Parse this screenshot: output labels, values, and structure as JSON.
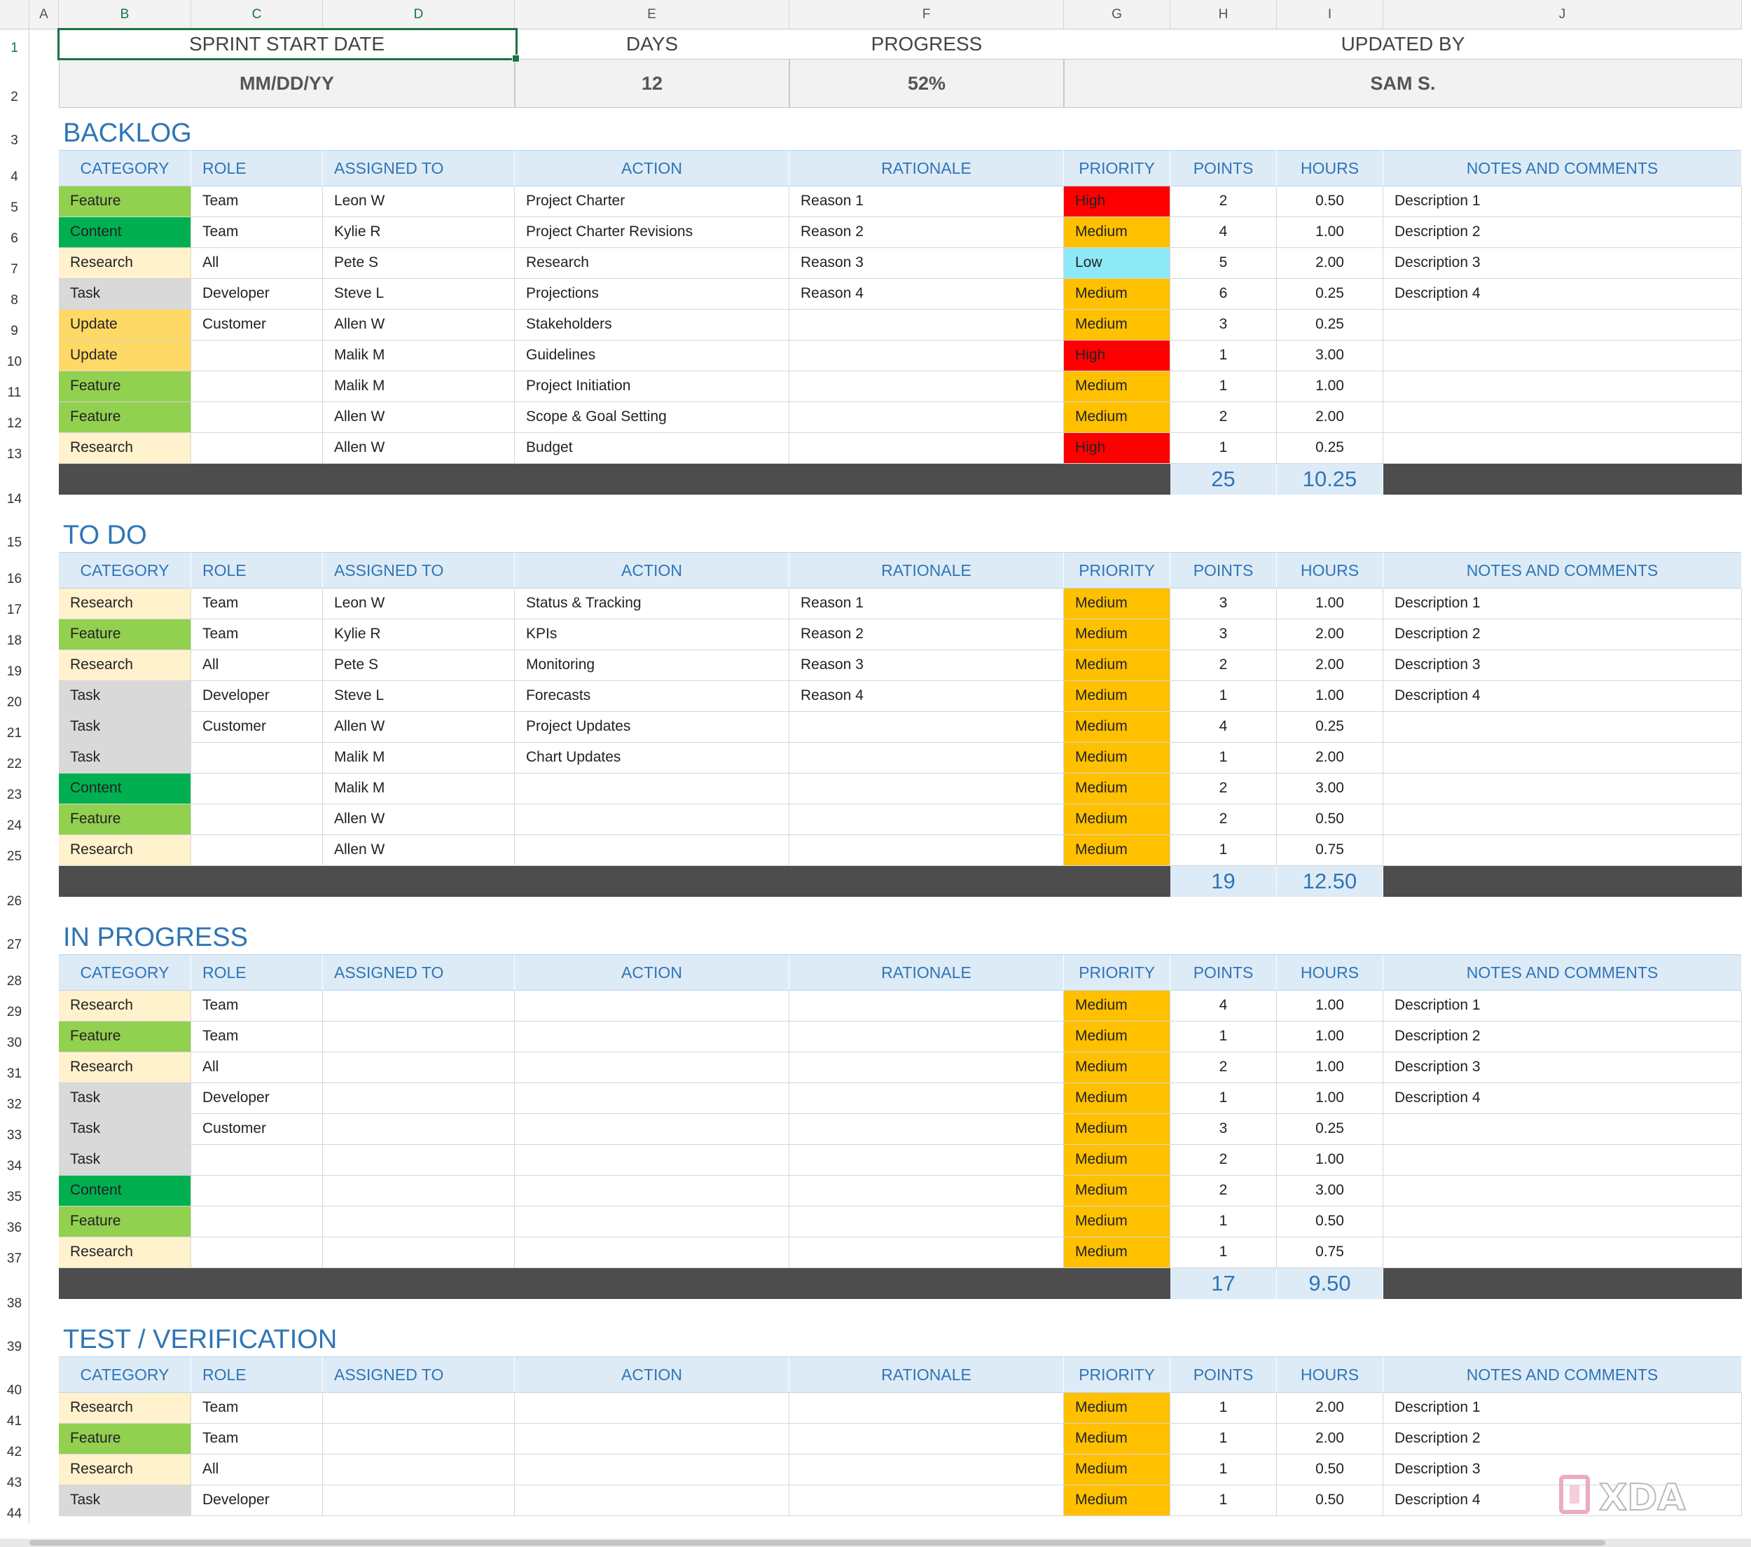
{
  "columns": [
    "A",
    "B",
    "C",
    "D",
    "E",
    "F",
    "G",
    "H",
    "I",
    "J"
  ],
  "rows": [
    "1",
    "2",
    "3",
    "4",
    "5",
    "6",
    "7",
    "8",
    "9",
    "10",
    "11",
    "12",
    "13",
    "14",
    "15",
    "16",
    "17",
    "18",
    "19",
    "20",
    "21",
    "22",
    "23",
    "24",
    "25",
    "26",
    "27",
    "28",
    "29",
    "30",
    "31",
    "32",
    "33",
    "34",
    "35",
    "36",
    "37",
    "38",
    "39",
    "40",
    "41",
    "42",
    "43",
    "44"
  ],
  "summary": {
    "labels": [
      "SPRINT START DATE",
      "DAYS",
      "PROGRESS",
      "UPDATED BY"
    ],
    "values": [
      "MM/DD/YY",
      "12",
      "52%",
      "SAM S."
    ]
  },
  "headers": [
    "CATEGORY",
    "ROLE",
    "ASSIGNED TO",
    "ACTION",
    "RATIONALE",
    "PRIORITY",
    "POINTS",
    "HOURS",
    "NOTES AND COMMENTS"
  ],
  "colors": {
    "Feature": "#92d050",
    "Content": "#00b050",
    "Research": "#fff2cc",
    "Task": "#d9d9d9",
    "Update": "#ffd966",
    "High": "#ff0000",
    "Medium": "#ffc000",
    "Low": "#8ee9f6",
    "accent": "#2f75b5"
  },
  "sections": [
    {
      "title": "BACKLOG",
      "rows": [
        [
          "Feature",
          "Team",
          "Leon W",
          "Project Charter",
          "Reason 1",
          "High",
          "2",
          "0.50",
          "Description 1"
        ],
        [
          "Content",
          "Team",
          "Kylie R",
          "Project Charter Revisions",
          "Reason 2",
          "Medium",
          "4",
          "1.00",
          "Description 2"
        ],
        [
          "Research",
          "All",
          "Pete S",
          "Research",
          "Reason 3",
          "Low",
          "5",
          "2.00",
          "Description 3"
        ],
        [
          "Task",
          "Developer",
          "Steve L",
          "Projections",
          "Reason 4",
          "Medium",
          "6",
          "0.25",
          "Description 4"
        ],
        [
          "Update",
          "Customer",
          "Allen W",
          "Stakeholders",
          "",
          "Medium",
          "3",
          "0.25",
          ""
        ],
        [
          "Update",
          "",
          "Malik M",
          "Guidelines",
          "",
          "High",
          "1",
          "3.00",
          ""
        ],
        [
          "Feature",
          "",
          "Malik M",
          "Project Initiation",
          "",
          "Medium",
          "1",
          "1.00",
          ""
        ],
        [
          "Feature",
          "",
          "Allen W",
          "Scope & Goal Setting",
          "",
          "Medium",
          "2",
          "2.00",
          ""
        ],
        [
          "Research",
          "",
          "Allen W",
          "Budget",
          "",
          "High",
          "1",
          "0.25",
          ""
        ]
      ],
      "total_points": "25",
      "total_hours": "10.25"
    },
    {
      "title": "TO DO",
      "rows": [
        [
          "Research",
          "Team",
          "Leon W",
          "Status & Tracking",
          "Reason 1",
          "Medium",
          "3",
          "1.00",
          "Description 1"
        ],
        [
          "Feature",
          "Team",
          "Kylie R",
          "KPIs",
          "Reason 2",
          "Medium",
          "3",
          "2.00",
          "Description 2"
        ],
        [
          "Research",
          "All",
          "Pete S",
          "Monitoring",
          "Reason 3",
          "Medium",
          "2",
          "2.00",
          "Description 3"
        ],
        [
          "Task",
          "Developer",
          "Steve L",
          "Forecasts",
          "Reason 4",
          "Medium",
          "1",
          "1.00",
          "Description 4"
        ],
        [
          "Task",
          "Customer",
          "Allen W",
          "Project Updates",
          "",
          "Medium",
          "4",
          "0.25",
          ""
        ],
        [
          "Task",
          "",
          "Malik M",
          "Chart Updates",
          "",
          "Medium",
          "1",
          "2.00",
          ""
        ],
        [
          "Content",
          "",
          "Malik M",
          "",
          "",
          "Medium",
          "2",
          "3.00",
          ""
        ],
        [
          "Feature",
          "",
          "Allen W",
          "",
          "",
          "Medium",
          "2",
          "0.50",
          ""
        ],
        [
          "Research",
          "",
          "Allen W",
          "",
          "",
          "Medium",
          "1",
          "0.75",
          ""
        ]
      ],
      "total_points": "19",
      "total_hours": "12.50"
    },
    {
      "title": "IN PROGRESS",
      "rows": [
        [
          "Research",
          "Team",
          "",
          "",
          "",
          "Medium",
          "4",
          "1.00",
          "Description 1"
        ],
        [
          "Feature",
          "Team",
          "",
          "",
          "",
          "Medium",
          "1",
          "1.00",
          "Description 2"
        ],
        [
          "Research",
          "All",
          "",
          "",
          "",
          "Medium",
          "2",
          "1.00",
          "Description 3"
        ],
        [
          "Task",
          "Developer",
          "",
          "",
          "",
          "Medium",
          "1",
          "1.00",
          "Description 4"
        ],
        [
          "Task",
          "Customer",
          "",
          "",
          "",
          "Medium",
          "3",
          "0.25",
          ""
        ],
        [
          "Task",
          "",
          "",
          "",
          "",
          "Medium",
          "2",
          "1.00",
          ""
        ],
        [
          "Content",
          "",
          "",
          "",
          "",
          "Medium",
          "2",
          "3.00",
          ""
        ],
        [
          "Feature",
          "",
          "",
          "",
          "",
          "Medium",
          "1",
          "0.50",
          ""
        ],
        [
          "Research",
          "",
          "",
          "",
          "",
          "Medium",
          "1",
          "0.75",
          ""
        ]
      ],
      "total_points": "17",
      "total_hours": "9.50"
    },
    {
      "title": "TEST / VERIFICATION",
      "rows": [
        [
          "Research",
          "Team",
          "",
          "",
          "",
          "Medium",
          "1",
          "2.00",
          "Description 1"
        ],
        [
          "Feature",
          "Team",
          "",
          "",
          "",
          "Medium",
          "1",
          "2.00",
          "Description 2"
        ],
        [
          "Research",
          "All",
          "",
          "",
          "",
          "Medium",
          "1",
          "0.50",
          "Description 3"
        ],
        [
          "Task",
          "Developer",
          "",
          "",
          "",
          "Medium",
          "1",
          "0.50",
          "Description 4"
        ]
      ]
    }
  ],
  "watermark": "XDA"
}
